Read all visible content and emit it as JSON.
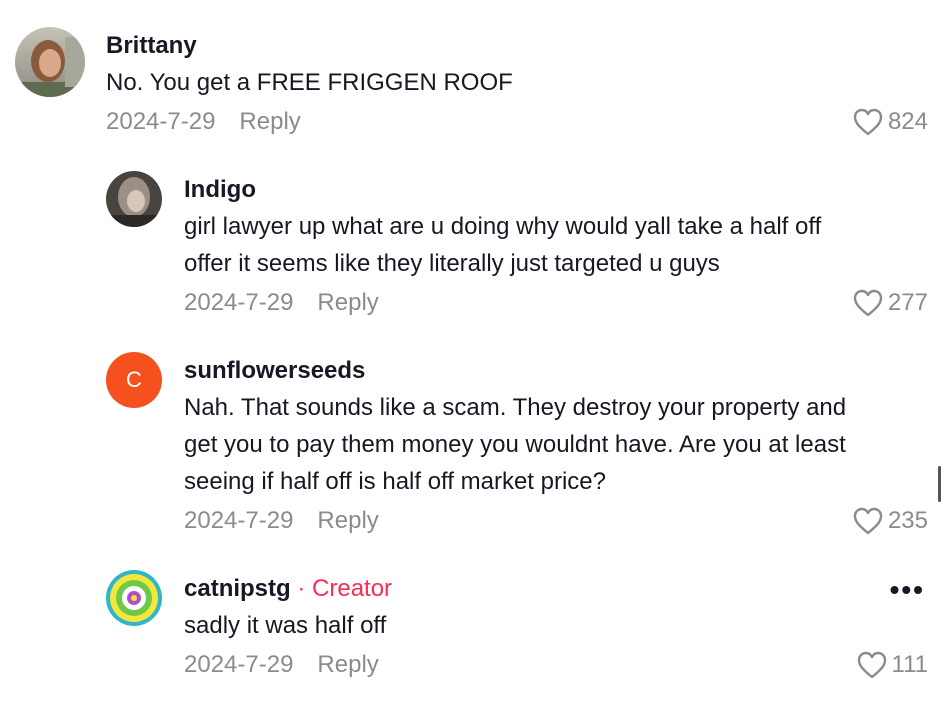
{
  "comments": [
    {
      "name": "Brittany",
      "text": "No. You get a FREE FRIGGEN ROOF",
      "date": "2024-7-29",
      "reply_label": "Reply",
      "likes": "824"
    },
    {
      "name": "Indigo",
      "text": "girl lawyer up what are u doing why would yall take a half off\noffer it seems like they literally just targeted u guys",
      "date": "2024-7-29",
      "reply_label": "Reply",
      "likes": "277"
    },
    {
      "name": "sunflowerseeds",
      "avatar_initial": "C",
      "avatar_color": "#F4511E",
      "text": "Nah. That sounds like a scam. They destroy your property and\nget you to pay them money you wouldnt have. Are you at least\nseeing if half off is half off market price?",
      "date": "2024-7-29",
      "reply_label": "Reply",
      "likes": "235"
    },
    {
      "name": "catnipstg",
      "creator_label": "· Creator",
      "text": "sadly it was half off",
      "date": "2024-7-29",
      "reply_label": "Reply",
      "likes": "111",
      "more_icon": "more-horizontal-icon"
    }
  ],
  "colors": {
    "creator_accent": "#FE2C55",
    "meta_gray": "#8a8b91",
    "text": "#161823"
  }
}
